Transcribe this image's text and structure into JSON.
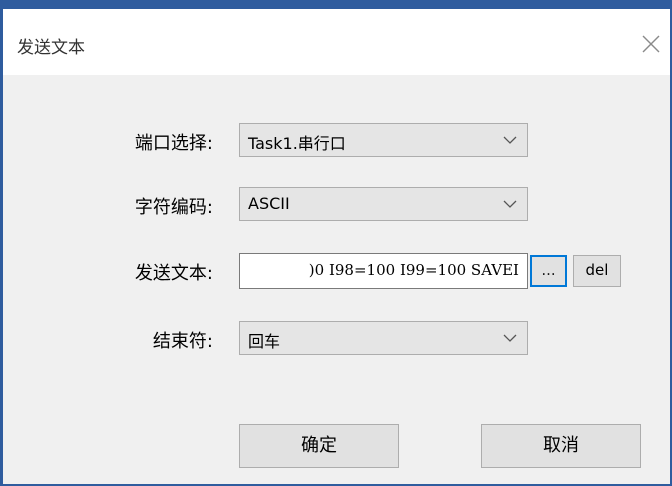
{
  "window": {
    "title": "发送文本"
  },
  "form": {
    "port_label": "端口选择:",
    "port_value": "Task1.串行口",
    "encoding_label": "字符编码:",
    "encoding_value": "ASCII",
    "text_label": "发送文本:",
    "text_value": ")0  I98=100  I99=100  SAVEI",
    "browse_label": "...",
    "del_label": "del",
    "terminator_label": "结束符:",
    "terminator_value": "回车"
  },
  "buttons": {
    "ok_label": "确定",
    "cancel_label": "取消"
  },
  "colors": {
    "accent": "#2f5c9e",
    "focus": "#0078d7",
    "dialog_bg": "#f0f0f0"
  },
  "icons": {
    "close": "close-icon",
    "dropdown": "chevron-down-icon"
  }
}
